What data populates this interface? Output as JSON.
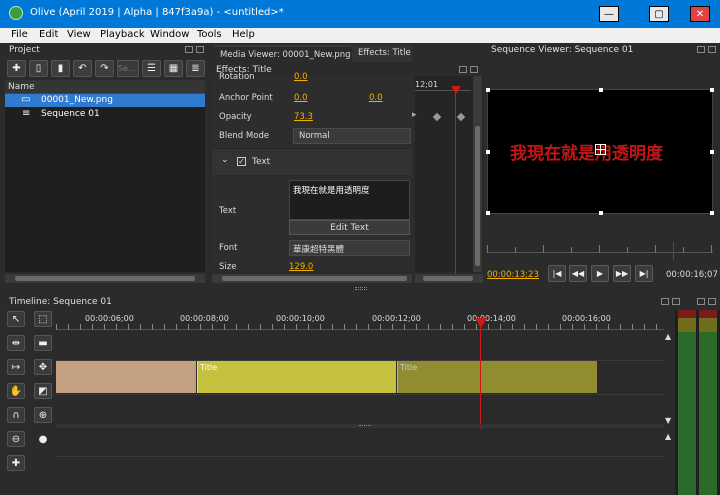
{
  "window": {
    "title": "Olive (April 2019 | Alpha | 847f3a9a) - <untitled>*",
    "minimize": "—",
    "restore": "▢",
    "close": "✕"
  },
  "menu": [
    "File",
    "Edit",
    "View",
    "Playback",
    "Window",
    "Tools",
    "Help"
  ],
  "project": {
    "header": "Project",
    "search_placeholder": "Se...",
    "column_name": "Name",
    "items": [
      {
        "name": "00001_New.png",
        "selected": true
      },
      {
        "name": "Sequence 01",
        "selected": false
      }
    ]
  },
  "effects": {
    "tabs": [
      "Media Viewer: 00001_New.png",
      "Effects: Title"
    ],
    "header": "Effects: Title",
    "partial_label": "Rotation",
    "partial_value": "0.0",
    "anchor": {
      "label": "Anchor Point",
      "x": "0.0",
      "y": "0.0"
    },
    "opacity": {
      "label": "Opacity",
      "value": "73.3"
    },
    "blend": {
      "label": "Blend Mode",
      "value": "Normal"
    },
    "text_section": {
      "label": "Text",
      "checked": true
    },
    "text": {
      "label": "Text",
      "value": "我現在就是用透明度",
      "edit_button": "Edit Text"
    },
    "font": {
      "label": "Font",
      "value": "華康超特黑體"
    },
    "size": {
      "label": "Size",
      "value": "129.0"
    },
    "keyframe_time": "12;01"
  },
  "viewer": {
    "header": "Sequence Viewer: Sequence 01",
    "overlay_text": "我現在就是用透明度",
    "current_time": "00:00:13;23",
    "end_time": "00:00:16;07"
  },
  "timeline": {
    "header": "Timeline: Sequence 01",
    "ticks": [
      "00:00:06;00",
      "00:00:08;00",
      "00:00:10;00",
      "00:00:12;00",
      "00:00:14;00",
      "00:00:16;00"
    ],
    "clips": [
      {
        "label": "",
        "color": "#c4a083"
      },
      {
        "label": "Title",
        "color": "#c5c03e"
      },
      {
        "label": "Title",
        "color": "#8f8c32"
      }
    ]
  },
  "colors": {
    "accent": "#f2b300",
    "playhead": "#d01818",
    "selection": "#2f7bd0"
  }
}
